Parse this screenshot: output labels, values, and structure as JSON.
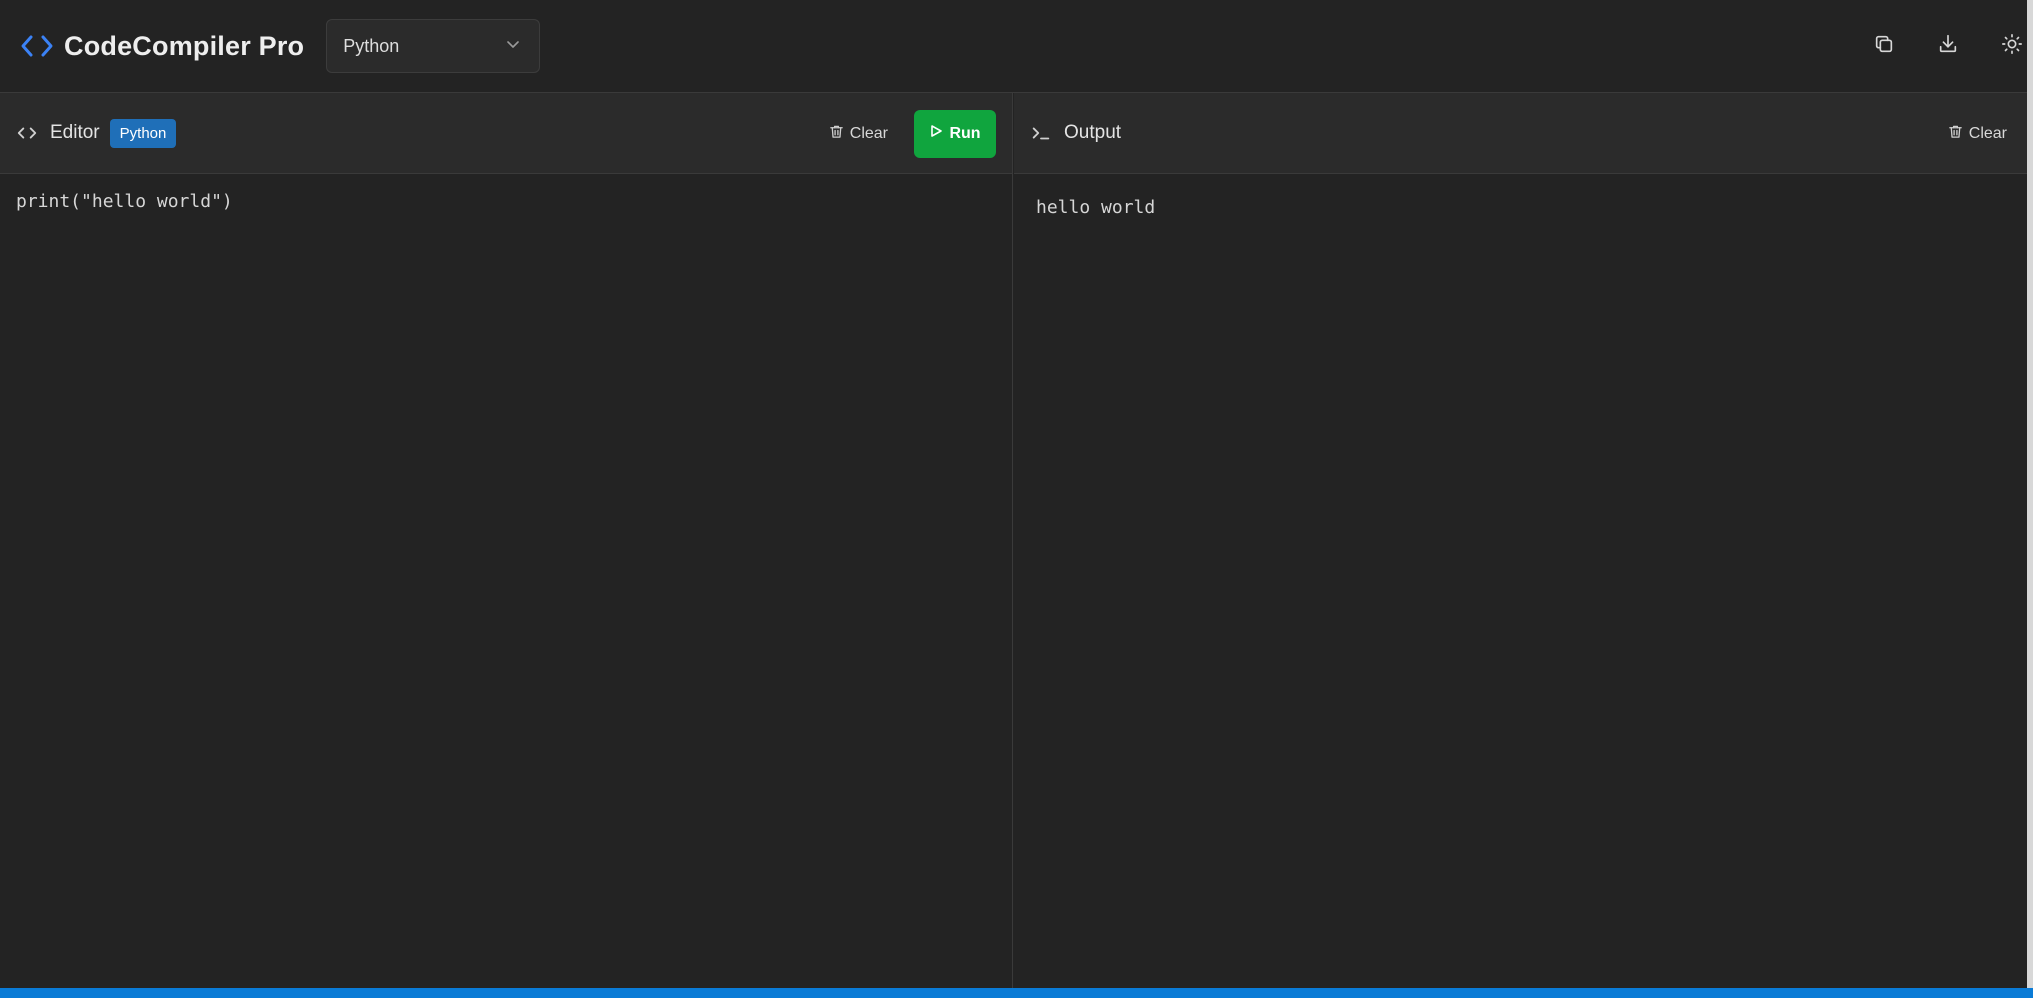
{
  "app": {
    "title": "CodeCompiler Pro",
    "accent_color": "#3b82f6"
  },
  "language_select": {
    "selected": "Python"
  },
  "top_actions": [
    {
      "name": "copy-icon"
    },
    {
      "name": "download-icon"
    },
    {
      "name": "sun-icon"
    }
  ],
  "editor": {
    "title": "Editor",
    "badge": "Python",
    "clear_label": "Clear",
    "run_label": "Run",
    "code": "print(\"hello world\")"
  },
  "output": {
    "title": "Output",
    "clear_label": "Clear",
    "text": "hello world"
  },
  "colors": {
    "background": "#232323",
    "header": "#2b2b2b",
    "run_button": "#10a53e",
    "badge": "#1f6fb8",
    "status_bar": "#0a7bd6"
  }
}
